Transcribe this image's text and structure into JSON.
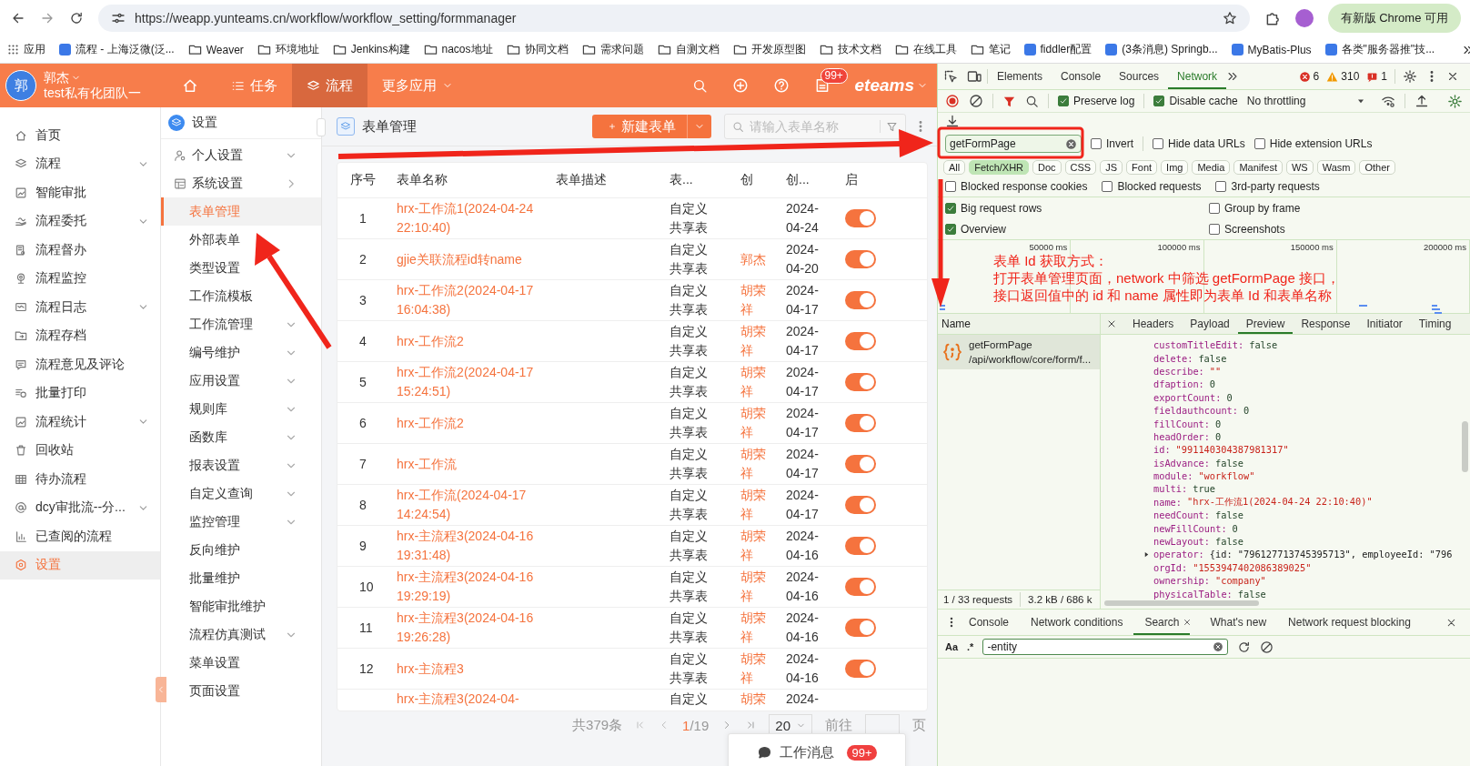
{
  "browser": {
    "url": "https://weapp.yunteams.cn/workflow/workflow_setting/formmanager",
    "update_button": "有新版 Chrome 可用",
    "bookmarks": [
      {
        "label": "应用",
        "kind": "apps"
      },
      {
        "label": "流程 - 上海泛微(泛...",
        "kind": "site"
      },
      {
        "label": "Weaver",
        "kind": "folder"
      },
      {
        "label": "环境地址",
        "kind": "folder"
      },
      {
        "label": "Jenkins构建",
        "kind": "folder"
      },
      {
        "label": "nacos地址",
        "kind": "folder"
      },
      {
        "label": "协同文档",
        "kind": "folder"
      },
      {
        "label": "需求问题",
        "kind": "folder"
      },
      {
        "label": "自测文档",
        "kind": "folder"
      },
      {
        "label": "开发原型图",
        "kind": "folder"
      },
      {
        "label": "技术文档",
        "kind": "folder"
      },
      {
        "label": "在线工具",
        "kind": "folder"
      },
      {
        "label": "笔记",
        "kind": "folder"
      },
      {
        "label": "fiddler配置",
        "kind": "site"
      },
      {
        "label": "(3条消息) Springb...",
        "kind": "site"
      },
      {
        "label": "MyBatis-Plus",
        "kind": "site"
      },
      {
        "label": "各类\"服务器推\"技...",
        "kind": "site"
      }
    ]
  },
  "app_header": {
    "user_initial": "郭",
    "user_name": "郭杰",
    "team": "test私有化团队一",
    "nav": [
      {
        "label": "任务",
        "selected": false,
        "kind": "tab"
      },
      {
        "label": "流程",
        "selected": true,
        "kind": "tab"
      },
      {
        "label": "更多应用",
        "selected": false,
        "kind": "menu"
      }
    ],
    "badge": "99+",
    "logo": "eteams"
  },
  "nav_sidebar": {
    "items": [
      {
        "label": "首页",
        "expandable": false,
        "selected": false
      },
      {
        "label": "流程",
        "expandable": true,
        "selected": false
      },
      {
        "label": "智能审批",
        "expandable": false,
        "selected": false
      },
      {
        "label": "流程委托",
        "expandable": true,
        "selected": false
      },
      {
        "label": "流程督办",
        "expandable": false,
        "selected": false
      },
      {
        "label": "流程监控",
        "expandable": false,
        "selected": false
      },
      {
        "label": "流程日志",
        "expandable": true,
        "selected": false
      },
      {
        "label": "流程存档",
        "expandable": false,
        "selected": false
      },
      {
        "label": "流程意见及评论",
        "expandable": false,
        "selected": false
      },
      {
        "label": "批量打印",
        "expandable": false,
        "selected": false
      },
      {
        "label": "流程统计",
        "expandable": true,
        "selected": false
      },
      {
        "label": "回收站",
        "expandable": false,
        "selected": false
      },
      {
        "label": "待办流程",
        "expandable": false,
        "selected": false
      },
      {
        "label": "dcy审批流--分...",
        "expandable": true,
        "selected": false
      },
      {
        "label": "已查阅的流程",
        "expandable": false,
        "selected": false
      },
      {
        "label": "设置",
        "expandable": false,
        "selected": true
      }
    ]
  },
  "sub_sidebar": {
    "title": "设置",
    "items": [
      {
        "label": "个人设置",
        "kind": "group",
        "expandable": true,
        "expanded": false,
        "selected": false
      },
      {
        "label": "系统设置",
        "kind": "group",
        "expandable": true,
        "expanded": true,
        "selected": false
      },
      {
        "label": "表单管理",
        "kind": "item",
        "expandable": false,
        "selected": true
      },
      {
        "label": "外部表单",
        "kind": "item",
        "expandable": false,
        "selected": false
      },
      {
        "label": "类型设置",
        "kind": "item",
        "expandable": false,
        "selected": false
      },
      {
        "label": "工作流模板",
        "kind": "item",
        "expandable": false,
        "selected": false
      },
      {
        "label": "工作流管理",
        "kind": "item",
        "expandable": true,
        "expanded": false,
        "selected": false
      },
      {
        "label": "编号维护",
        "kind": "item",
        "expandable": true,
        "expanded": false,
        "selected": false
      },
      {
        "label": "应用设置",
        "kind": "item",
        "expandable": true,
        "expanded": false,
        "selected": false
      },
      {
        "label": "规则库",
        "kind": "item",
        "expandable": true,
        "expanded": false,
        "selected": false
      },
      {
        "label": "函数库",
        "kind": "item",
        "expandable": true,
        "expanded": false,
        "selected": false
      },
      {
        "label": "报表设置",
        "kind": "item",
        "expandable": true,
        "expanded": false,
        "selected": false
      },
      {
        "label": "自定义查询",
        "kind": "item",
        "expandable": true,
        "expanded": false,
        "selected": false
      },
      {
        "label": "监控管理",
        "kind": "item",
        "expandable": true,
        "expanded": false,
        "selected": false
      },
      {
        "label": "反向维护",
        "kind": "item",
        "expandable": false,
        "selected": false
      },
      {
        "label": "批量维护",
        "kind": "item",
        "expandable": false,
        "selected": false
      },
      {
        "label": "智能审批维护",
        "kind": "item",
        "expandable": false,
        "selected": false
      },
      {
        "label": "流程仿真测试",
        "kind": "item",
        "expandable": true,
        "expanded": false,
        "selected": false
      },
      {
        "label": "菜单设置",
        "kind": "item",
        "expandable": false,
        "selected": false
      },
      {
        "label": "页面设置",
        "kind": "item",
        "expandable": false,
        "selected": false
      }
    ]
  },
  "form_list": {
    "title": "表单管理",
    "new_button": "新建表单",
    "search_placeholder": "请输入表单名称",
    "columns": [
      "序号",
      "表单名称",
      "表单描述",
      "表...",
      "创",
      "创...",
      "启"
    ],
    "rows": [
      {
        "index": "1",
        "name": "hrx-工作流1(2024-04-24 22:10:40)",
        "type": "自定义共享表",
        "date": "2024-04-24",
        "enabled": true
      },
      {
        "index": "2",
        "name": "gjie关联流程id转name",
        "type": "自定义共享表",
        "creator": "郭杰",
        "date": "2024-04-20",
        "enabled": true
      },
      {
        "index": "3",
        "name": "hrx-工作流2(2024-04-17 16:04:38)",
        "type": "自定义共享表",
        "creator": "胡荣祥",
        "date": "2024-04-17",
        "enabled": true
      },
      {
        "index": "4",
        "name": "hrx-工作流2",
        "type": "自定义共享表",
        "creator": "胡荣祥",
        "date": "2024-04-17",
        "enabled": true
      },
      {
        "index": "5",
        "name": "hrx-工作流2(2024-04-17 15:24:51)",
        "type": "自定义共享表",
        "creator": "胡荣祥",
        "date": "2024-04-17",
        "enabled": true
      },
      {
        "index": "6",
        "name": "hrx-工作流2",
        "type": "自定义共享表",
        "creator": "胡荣祥",
        "date": "2024-04-17",
        "enabled": true
      },
      {
        "index": "7",
        "name": "hrx-工作流",
        "type": "自定义共享表",
        "creator": "胡荣祥",
        "date": "2024-04-17",
        "enabled": true
      },
      {
        "index": "8",
        "name": "hrx-工作流(2024-04-17 14:24:54)",
        "type": "自定义共享表",
        "creator": "胡荣祥",
        "date": "2024-04-17",
        "enabled": true
      },
      {
        "index": "9",
        "name": "hrx-主流程3(2024-04-16 19:31:48)",
        "type": "自定义共享表",
        "creator": "胡荣祥",
        "date": "2024-04-16",
        "enabled": true
      },
      {
        "index": "10",
        "name": "hrx-主流程3(2024-04-16 19:29:19)",
        "type": "自定义共享表",
        "creator": "胡荣祥",
        "date": "2024-04-16",
        "enabled": true
      },
      {
        "index": "11",
        "name": "hrx-主流程3(2024-04-16 19:26:28)",
        "type": "自定义共享表",
        "creator": "胡荣祥",
        "date": "2024-04-16",
        "enabled": true
      },
      {
        "index": "12",
        "name": "hrx-主流程3",
        "type": "自定义共享表",
        "creator": "胡荣祥",
        "date": "2024-04-16",
        "enabled": true
      },
      {
        "name": "hrx-主流程3(2024-04-",
        "type": "自定义",
        "creator": "胡荣",
        "date": "2024-"
      }
    ],
    "pagination": {
      "total": "共379条",
      "page": "1",
      "page_total": "/19",
      "page_size": "20",
      "goto": "前往",
      "page_unit": "页"
    },
    "message_button": "工作消息",
    "message_badge": "99+"
  },
  "devtools": {
    "tabs": [
      {
        "label": "Elements",
        "selected": false
      },
      {
        "label": "Console",
        "selected": false
      },
      {
        "label": "Sources",
        "selected": false
      },
      {
        "label": "Network",
        "selected": true
      }
    ],
    "counts": {
      "errors": "6",
      "warnings": "310",
      "issues": "1"
    },
    "preserve_log": {
      "label": "Preserve log",
      "checked": true
    },
    "disable_cache": {
      "label": "Disable cache",
      "checked": true
    },
    "throttling": "No throttling",
    "filter": {
      "value": "getFormPage",
      "options": [
        {
          "label": "Invert",
          "checked": false
        },
        {
          "label": "Hide data URLs",
          "checked": false
        },
        {
          "label": "Hide extension URLs",
          "checked": false
        }
      ]
    },
    "types": [
      {
        "label": "All",
        "selected": false
      },
      {
        "label": "Fetch/XHR",
        "selected": true
      },
      {
        "label": "Doc",
        "selected": false
      },
      {
        "label": "CSS",
        "selected": false
      },
      {
        "label": "JS",
        "selected": false
      },
      {
        "label": "Font",
        "selected": false
      },
      {
        "label": "Img",
        "selected": false
      },
      {
        "label": "Media",
        "selected": false
      },
      {
        "label": "Manifest",
        "selected": false
      },
      {
        "label": "WS",
        "selected": false
      },
      {
        "label": "Wasm",
        "selected": false
      },
      {
        "label": "Other",
        "selected": false
      }
    ],
    "blocked": [
      {
        "label": "Blocked response cookies",
        "checked": false
      },
      {
        "label": "Blocked requests",
        "checked": false
      },
      {
        "label": "3rd-party requests",
        "checked": false
      }
    ],
    "settings": [
      {
        "label": "Big request rows",
        "checked": true
      },
      {
        "label": "Group by frame",
        "checked": false
      },
      {
        "label": "Overview",
        "checked": true
      },
      {
        "label": "Screenshots",
        "checked": false
      }
    ],
    "timeline_ticks": [
      "50000 ms",
      "100000 ms",
      "150000 ms",
      "200000 ms"
    ],
    "name_header": "Name",
    "requests": [
      {
        "name": "getFormPage",
        "path": "/api/workflow/core/form/f...",
        "selected": true
      }
    ],
    "detail_tabs": [
      {
        "label": "Headers",
        "selected": false
      },
      {
        "label": "Payload",
        "selected": false
      },
      {
        "label": "Preview",
        "selected": true
      },
      {
        "label": "Response",
        "selected": false
      },
      {
        "label": "Initiator",
        "selected": false
      },
      {
        "label": "Timing",
        "selected": false
      }
    ],
    "preview": [
      {
        "key": "customTitleEdit:",
        "value": "false",
        "kind": "literal"
      },
      {
        "key": "delete:",
        "value": "false",
        "kind": "literal"
      },
      {
        "key": "describe:",
        "value": "\"\"",
        "kind": "string"
      },
      {
        "key": "dfaption:",
        "value": "0",
        "kind": "literal"
      },
      {
        "key": "exportCount:",
        "value": "0",
        "kind": "literal"
      },
      {
        "key": "fieldauthcount:",
        "value": "0",
        "kind": "literal"
      },
      {
        "key": "fillCount:",
        "value": "0",
        "kind": "literal"
      },
      {
        "key": "headOrder:",
        "value": "0",
        "kind": "literal"
      },
      {
        "key": "id:",
        "value": "\"991140304387981317\"",
        "kind": "string"
      },
      {
        "key": "isAdvance:",
        "value": "false",
        "kind": "literal"
      },
      {
        "key": "module:",
        "value": "\"workflow\"",
        "kind": "string"
      },
      {
        "key": "multi:",
        "value": "true",
        "kind": "literal"
      },
      {
        "key": "name:",
        "value": "\"hrx-工作流1(2024-04-24 22:10:40)\"",
        "kind": "string"
      },
      {
        "key": "needCount:",
        "value": "false",
        "kind": "literal"
      },
      {
        "key": "newFillCount:",
        "value": "0",
        "kind": "literal"
      },
      {
        "key": "newLayout:",
        "value": "false",
        "kind": "literal"
      },
      {
        "key": "operator:",
        "value": "{id: \"796127713745395713\", employeeId: \"796",
        "kind": "object"
      },
      {
        "key": "orgId:",
        "value": "\"1553947402086389025\"",
        "kind": "string"
      },
      {
        "key": "ownership:",
        "value": "\"company\"",
        "kind": "string"
      },
      {
        "key": "physicalTable:",
        "value": "false",
        "kind": "literal"
      }
    ],
    "status": {
      "requests": "1 / 33 requests",
      "transferred": "3.2 kB / 686 k"
    },
    "drawer_tabs": [
      {
        "label": "Console",
        "selected": false,
        "closable": false
      },
      {
        "label": "Network conditions",
        "selected": false,
        "closable": false
      },
      {
        "label": "Search",
        "selected": true,
        "closable": true
      },
      {
        "label": "What's new",
        "selected": false,
        "closable": false
      },
      {
        "label": "Network request blocking",
        "selected": false,
        "closable": false
      }
    ],
    "search": {
      "case_toggle": "Aa",
      "regex_toggle": ".*",
      "query": "-entity"
    }
  },
  "annotation": {
    "lines": [
      "表单 Id 获取方式：",
      "打开表单管理页面，network 中筛选 getFormPage 接口，",
      "接口返回值中的 id 和 name 属性即为表单 Id 和表单名称"
    ]
  }
}
